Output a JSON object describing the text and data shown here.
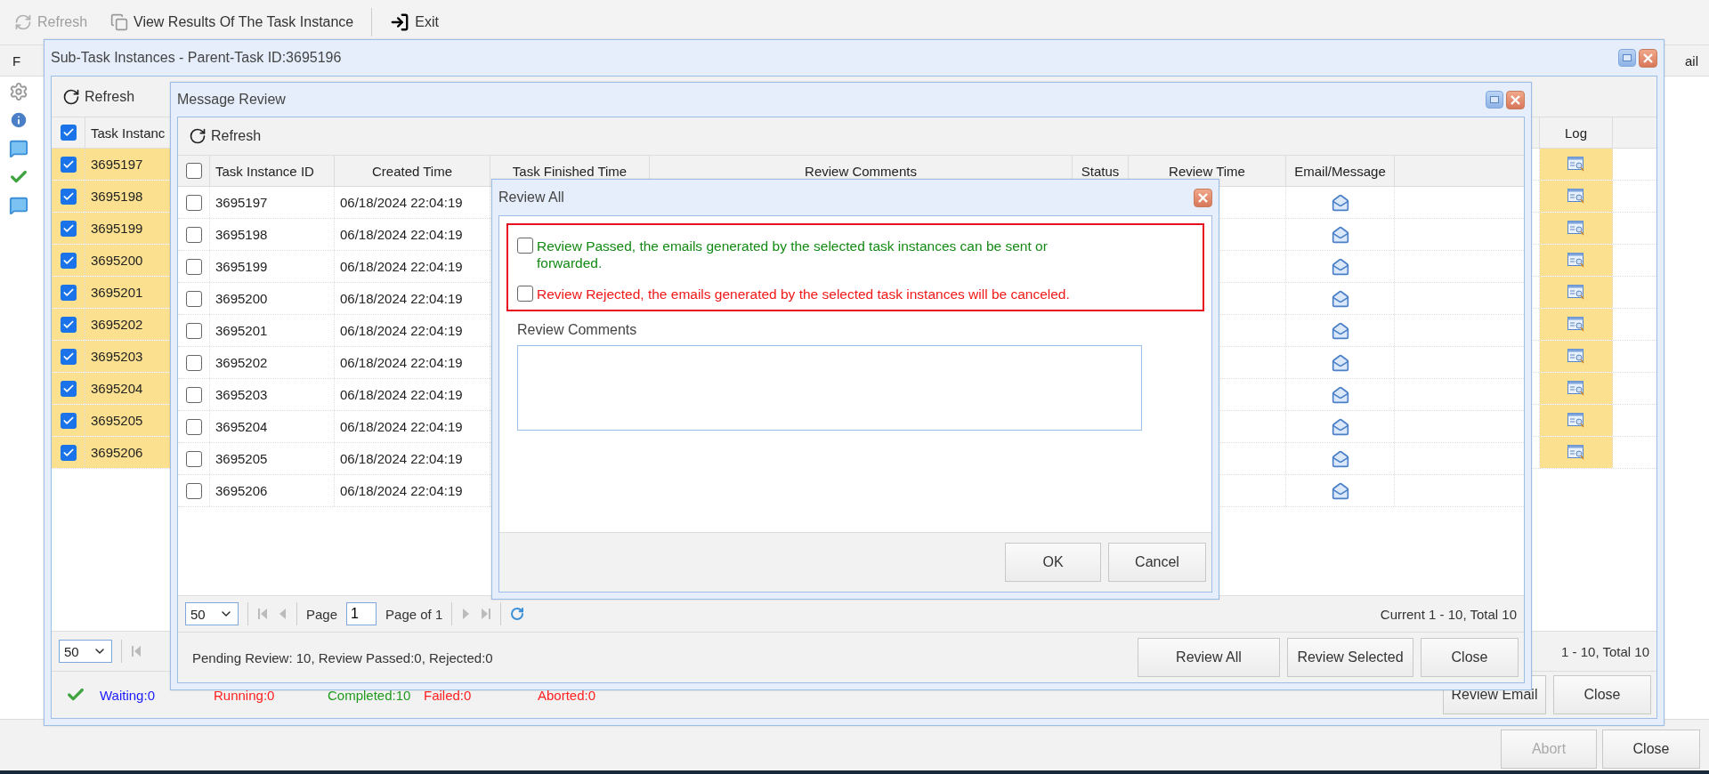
{
  "toolbar": [
    {
      "label": "Refresh",
      "disabled": true,
      "kind": "refresh"
    },
    {
      "label": "View Results Of The Task Instance",
      "disabled": false,
      "kind": "results"
    },
    {
      "label": "Exit",
      "disabled": false,
      "kind": "exit"
    }
  ],
  "background_grid": {
    "column_1": "F",
    "column_last": "ail"
  },
  "background_buttons": [
    {
      "label": "Abort",
      "disabled": true
    },
    {
      "label": "Close",
      "disabled": false
    }
  ],
  "subtask_window": {
    "title": "Sub-Task Instances - Parent-Task ID:3695196",
    "toolbar_button": "Refresh",
    "header_checked": true,
    "columns": [
      "Task Instanc",
      "Log"
    ],
    "rows": [
      {
        "id": "3695197",
        "checked": true,
        "selected": true
      },
      {
        "id": "3695198",
        "checked": true,
        "selected": true
      },
      {
        "id": "3695199",
        "checked": true,
        "selected": true
      },
      {
        "id": "3695200",
        "checked": true,
        "selected": true
      },
      {
        "id": "3695201",
        "checked": true,
        "selected": true
      },
      {
        "id": "3695202",
        "checked": true,
        "selected": true
      },
      {
        "id": "3695203",
        "checked": true,
        "selected": true
      },
      {
        "id": "3695204",
        "checked": true,
        "selected": true
      },
      {
        "id": "3695205",
        "checked": true,
        "selected": true
      },
      {
        "id": "3695206",
        "checked": true,
        "selected": true
      }
    ],
    "page_size": "50",
    "page_summary": "1 - 10, Total 10",
    "status": [
      {
        "label": "Waiting:0",
        "color": "#1a1aff"
      },
      {
        "label": "Running:0",
        "color": "#ff2020"
      },
      {
        "label": "Completed:10",
        "color": "#1f9a1f"
      },
      {
        "label": "Failed:0",
        "color": "#ff2020"
      },
      {
        "label": "Aborted:0",
        "color": "#ff2020"
      }
    ],
    "buttons": [
      "Review Email",
      "Close"
    ]
  },
  "message_window": {
    "title": "Message Review",
    "toolbar_button": "Refresh",
    "header_checked": false,
    "columns": [
      "Task Instance ID",
      "Created Time",
      "Task Finished Time",
      "Review Comments",
      "Status",
      "Review Time",
      "Email/Message"
    ],
    "rows": [
      {
        "id": "3695197",
        "created": "06/18/2024 22:04:19",
        "checked": false
      },
      {
        "id": "3695198",
        "created": "06/18/2024 22:04:19",
        "checked": false
      },
      {
        "id": "3695199",
        "created": "06/18/2024 22:04:19",
        "checked": false
      },
      {
        "id": "3695200",
        "created": "06/18/2024 22:04:19",
        "checked": false
      },
      {
        "id": "3695201",
        "created": "06/18/2024 22:04:19",
        "checked": false
      },
      {
        "id": "3695202",
        "created": "06/18/2024 22:04:19",
        "checked": false
      },
      {
        "id": "3695203",
        "created": "06/18/2024 22:04:19",
        "checked": false
      },
      {
        "id": "3695204",
        "created": "06/18/2024 22:04:19",
        "checked": false
      },
      {
        "id": "3695205",
        "created": "06/18/2024 22:04:19",
        "checked": false
      },
      {
        "id": "3695206",
        "created": "06/18/2024 22:04:19",
        "checked": false
      }
    ],
    "pager": {
      "page_size": "50",
      "page_label": "Page",
      "page": "1",
      "page_of": "Page of 1",
      "summary": "Current 1 - 10, Total 10"
    },
    "footer_text": "Pending Review: 10, Review Passed:0, Rejected:0",
    "buttons": [
      "Review All",
      "Review Selected",
      "Close"
    ]
  },
  "review_dialog": {
    "title": "Review All",
    "options": [
      {
        "label": "Review Passed, the emails generated by the selected task instances can be sent or forwarded.",
        "checked": false,
        "color": "#138a13"
      },
      {
        "label": "Review Rejected, the emails generated by the selected task instances will be canceled.",
        "checked": false,
        "color": "#f01818"
      }
    ],
    "comments_label": "Review Comments",
    "buttons": [
      "OK",
      "Cancel"
    ]
  }
}
